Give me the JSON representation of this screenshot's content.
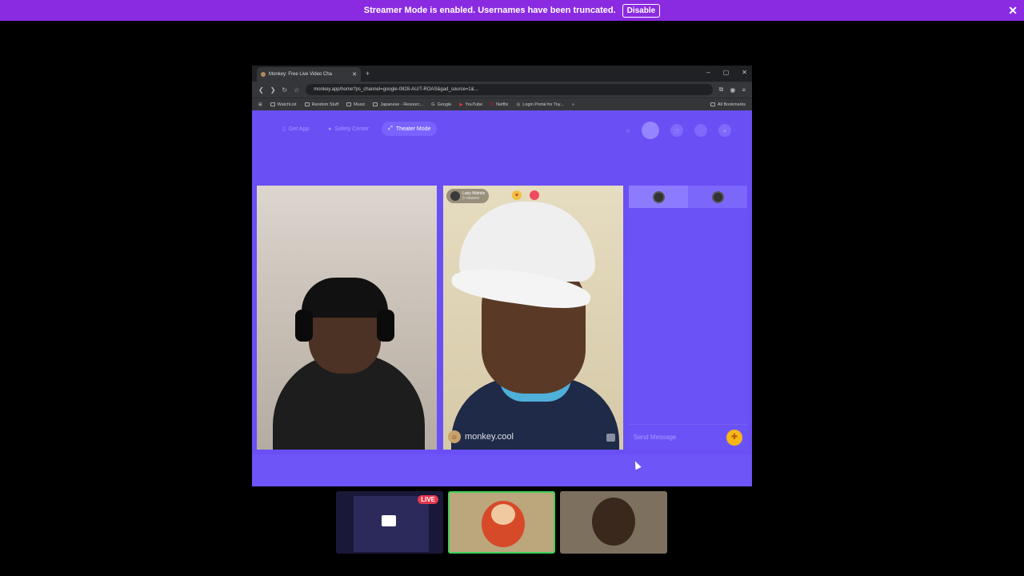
{
  "banner": {
    "message": "Streamer Mode is enabled. Usernames have been truncated.",
    "disable_label": "Disable",
    "close_glyph": "✕"
  },
  "browser": {
    "tab_title": "Monkey: Free Live Video Cha",
    "tab_close": "✕",
    "new_tab": "+",
    "window_controls": [
      "–",
      "▢",
      "✕"
    ],
    "url": "monkey.app/home?ps_channel=google-0828-AU/T-ROAS&gad_source=1&...",
    "bookmarks": [
      "WatchList",
      "Random Stuff",
      "Music",
      "Japanese - Resourc...",
      "Google",
      "YouTube",
      "Netflix",
      "Login Portal for Toy..."
    ],
    "all_bookmarks": "All Bookmarks"
  },
  "page": {
    "nav": [
      "Get App",
      "Safety Center",
      "Theater Mode"
    ],
    "active_nav": "Theater Mode",
    "video_left": {},
    "video_right": {
      "username": "Lady Midnite",
      "sublabel": "3 viewers",
      "watermark": "monkey.cool"
    },
    "chat": {
      "placeholder": "Send Message"
    }
  },
  "thumbnails": {
    "live_label": "LIVE"
  },
  "colors": {
    "banner": "#8a2be2",
    "page_bg": "#6a4ff5",
    "live": "#e6364e",
    "selected_border": "#3fd05a",
    "gift": "#f5b716"
  }
}
